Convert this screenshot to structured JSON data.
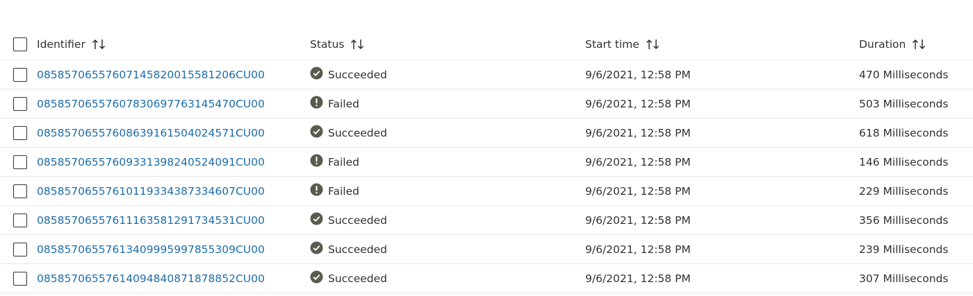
{
  "columns": {
    "identifier": "Identifier",
    "status": "Status",
    "start_time": "Start time",
    "duration": "Duration"
  },
  "icons": {
    "sort": "sort-up-down-icon",
    "succeeded": "check-circle-icon",
    "failed": "exclamation-circle-icon"
  },
  "colors": {
    "link": "#1c6cab",
    "status_icon": "#5a5a4e",
    "divider": "#e8e8e8"
  },
  "rows": [
    {
      "id": "08585706557607145820015581206CU00",
      "status": "Succeeded",
      "start": "9/6/2021, 12:58 PM",
      "duration": "470 Milliseconds"
    },
    {
      "id": "08585706557607830697763145470CU00",
      "status": "Failed",
      "start": "9/6/2021, 12:58 PM",
      "duration": "503 Milliseconds"
    },
    {
      "id": "08585706557608639161504024571CU00",
      "status": "Succeeded",
      "start": "9/6/2021, 12:58 PM",
      "duration": "618 Milliseconds"
    },
    {
      "id": "08585706557609331398240524091CU00",
      "status": "Failed",
      "start": "9/6/2021, 12:58 PM",
      "duration": "146 Milliseconds"
    },
    {
      "id": "08585706557610119334387334607CU00",
      "status": "Failed",
      "start": "9/6/2021, 12:58 PM",
      "duration": "229 Milliseconds"
    },
    {
      "id": "08585706557611163581291734531CU00",
      "status": "Succeeded",
      "start": "9/6/2021, 12:58 PM",
      "duration": "356 Milliseconds"
    },
    {
      "id": "08585706557613409995997855309CU00",
      "status": "Succeeded",
      "start": "9/6/2021, 12:58 PM",
      "duration": "239 Milliseconds"
    },
    {
      "id": "08585706557614094840871878852CU00",
      "status": "Succeeded",
      "start": "9/6/2021, 12:58 PM",
      "duration": "307 Milliseconds"
    }
  ]
}
